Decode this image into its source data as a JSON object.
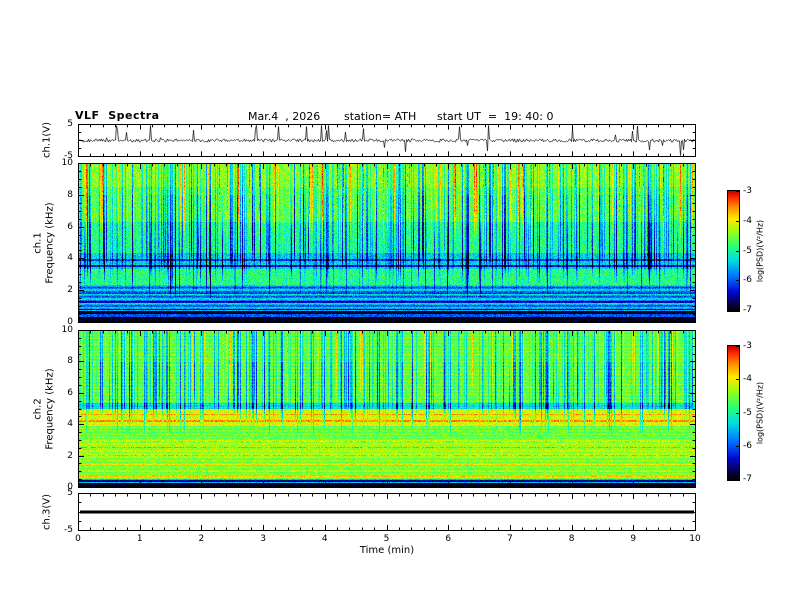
{
  "header": {
    "title": "VLF  Spectra",
    "date": "Mar.4  , 2026",
    "station": "station= ATH",
    "start_ut": "start UT  =  19: 40: 0"
  },
  "xaxis": {
    "label": "Time  (min)",
    "lim": [
      0,
      10
    ],
    "ticks": [
      0,
      1,
      2,
      3,
      4,
      5,
      6,
      7,
      8,
      9,
      10
    ]
  },
  "palette": {
    "name": "rainbow",
    "stops": [
      [
        0,
        0,
        0,
        0
      ],
      [
        0.07,
        8,
        0,
        90
      ],
      [
        0.16,
        0,
        10,
        210
      ],
      [
        0.28,
        0,
        110,
        255
      ],
      [
        0.42,
        0,
        220,
        225
      ],
      [
        0.54,
        40,
        255,
        120
      ],
      [
        0.66,
        150,
        255,
        20
      ],
      [
        0.77,
        255,
        235,
        0
      ],
      [
        0.87,
        255,
        140,
        0
      ],
      [
        0.95,
        255,
        40,
        0
      ],
      [
        1,
        205,
        0,
        0
      ]
    ]
  },
  "chart_data": [
    {
      "id": "ch1_waveform",
      "type": "line",
      "ylabel": "ch.1(V)",
      "ylim": [
        -5,
        5
      ],
      "yticks": [
        5,
        -5
      ],
      "xlim": [
        0,
        10
      ],
      "description": "broadband noise around 0 V with many impulsive sferic spikes up to about +/-4 V",
      "render": {
        "noise_amp_v": 0.5,
        "spike_density": 0.05,
        "spike_max_v": 4.2,
        "seed": 11
      }
    },
    {
      "id": "ch1_spectrogram",
      "type": "heatmap",
      "ylabel_lines": [
        "ch.1",
        "Frequency  (kHz)"
      ],
      "ylim": [
        0,
        10
      ],
      "yticks": [
        0,
        2,
        4,
        6,
        8,
        10
      ],
      "colorbar": {
        "label": "log(PSD)(V²/Hz)",
        "ticks": [
          -3,
          -4,
          -5,
          -6,
          -7
        ],
        "lim": [
          -7,
          -3
        ]
      },
      "description": "green background ~-4.6; blue band 1-2.3 kHz; dark lines near 3.5-4 kHz; black bands below 0.75 kHz; dense vertical blue sferic streaks 1.5-10 kHz; orange-yellow streaks above 5 kHz",
      "render": {
        "seed": 22,
        "noise": 0.6,
        "bands": [
          {
            "f": [
              0,
              0.35
            ],
            "level": -7.0
          },
          {
            "f": [
              0.35,
              0.55
            ],
            "level": -6.0
          },
          {
            "f": [
              0.55,
              0.75
            ],
            "level": -6.9
          },
          {
            "f": [
              0.75,
              0.95
            ],
            "level": -5.6
          },
          {
            "f": [
              0.95,
              2.35
            ],
            "level": -5.65
          },
          {
            "f": [
              2.35,
              3.35
            ],
            "level": -4.9
          },
          {
            "f": [
              3.35,
              4.35
            ],
            "level": -5.35
          },
          {
            "f": [
              4.35,
              6.3
            ],
            "level": -4.9
          },
          {
            "f": [
              6.3,
              8.5
            ],
            "level": -4.6
          },
          {
            "f": [
              8.5,
              10.01
            ],
            "level": -4.4
          }
        ],
        "lines": [
          {
            "f": 3.55,
            "w": 0.05,
            "level": -6.3
          },
          {
            "f": 3.95,
            "w": 0.05,
            "level": -6.1
          },
          {
            "f": 1.3,
            "w": 0.05,
            "level": -6.4
          },
          {
            "f": 1.85,
            "w": 0.04,
            "level": -6.2
          },
          {
            "f": 0.85,
            "w": 0.04,
            "level": -6.6
          }
        ],
        "ripple": {
          "range": [
            0.95,
            2.35
          ],
          "amp": 0.4,
          "freq": 22
        },
        "streaks": {
          "density": 0.5,
          "strength": 1.8,
          "range": [
            1.4,
            10
          ],
          "bot_jitter": 2.5
        },
        "hot": {
          "density": 0.3,
          "boost": 1.2,
          "range": [
            5.0,
            10
          ]
        }
      }
    },
    {
      "id": "ch2_spectrogram",
      "type": "heatmap",
      "ylabel_lines": [
        "ch.2",
        "Frequency  (kHz)"
      ],
      "ylim": [
        0,
        10
      ],
      "yticks": [
        0,
        2,
        4,
        6,
        8,
        10
      ],
      "colorbar": {
        "label": "log(PSD)(V²/Hz)",
        "ticks": [
          -3,
          -4,
          -5,
          -6,
          -7
        ],
        "lim": [
          -7,
          -3
        ]
      },
      "description": "green-yellow background; bright yellow band 3.9-5 kHz with orange hum lines near 2, 2.5, 3, 4.3, 4.7 kHz; dark row ~5.2 kHz; black band below 0.3 kHz; vertical blue sferic streaks above ~4 kHz",
      "render": {
        "seed": 33,
        "noise": 0.5,
        "bands": [
          {
            "f": [
              0,
              0.3
            ],
            "level": -7.0
          },
          {
            "f": [
              0.3,
              0.55
            ],
            "level": -5.4
          },
          {
            "f": [
              0.55,
              1.9
            ],
            "level": -4.45
          },
          {
            "f": [
              1.9,
              3.1
            ],
            "level": -4.3
          },
          {
            "f": [
              3.1,
              3.9
            ],
            "level": -4.55
          },
          {
            "f": [
              3.9,
              5.0
            ],
            "level": -4.05
          },
          {
            "f": [
              5.0,
              5.35
            ],
            "level": -5.2
          },
          {
            "f": [
              5.35,
              10.01
            ],
            "level": -4.55
          }
        ],
        "lines": [
          {
            "f": 0.45,
            "w": 0.05,
            "level": -6.6
          },
          {
            "f": 0.75,
            "w": 0.04,
            "level": -3.8
          },
          {
            "f": 1.05,
            "w": 0.04,
            "level": -3.9
          },
          {
            "f": 1.5,
            "w": 0.04,
            "level": -4.0
          },
          {
            "f": 2.05,
            "w": 0.05,
            "level": -3.6
          },
          {
            "f": 2.55,
            "w": 0.04,
            "level": -3.75
          },
          {
            "f": 2.95,
            "w": 0.04,
            "level": -3.85
          },
          {
            "f": 4.25,
            "w": 0.05,
            "level": -3.6
          },
          {
            "f": 4.65,
            "w": 0.04,
            "level": -3.7
          }
        ],
        "ripple": {
          "range": [
            0,
            10
          ],
          "amp": 0.12,
          "freq": 30
        },
        "streaks": {
          "density": 0.5,
          "strength": 1.7,
          "range": [
            3.2,
            10
          ],
          "bot_jitter": 1.8
        },
        "hot": {
          "density": 0.12,
          "boost": 0.8,
          "range": [
            5.5,
            10
          ]
        }
      }
    },
    {
      "id": "ch3_waveform",
      "type": "line",
      "ylabel": "ch.3(V)",
      "ylim": [
        -5,
        5
      ],
      "yticks": [
        5,
        -5
      ],
      "description": "flat thick line at 0 V (no signal on channel 3)",
      "render": {
        "flat_value": 0,
        "thickness_px": 3
      }
    }
  ],
  "colors": {
    "axis": "#000000",
    "background": "#ffffff",
    "trace": "#000000"
  }
}
